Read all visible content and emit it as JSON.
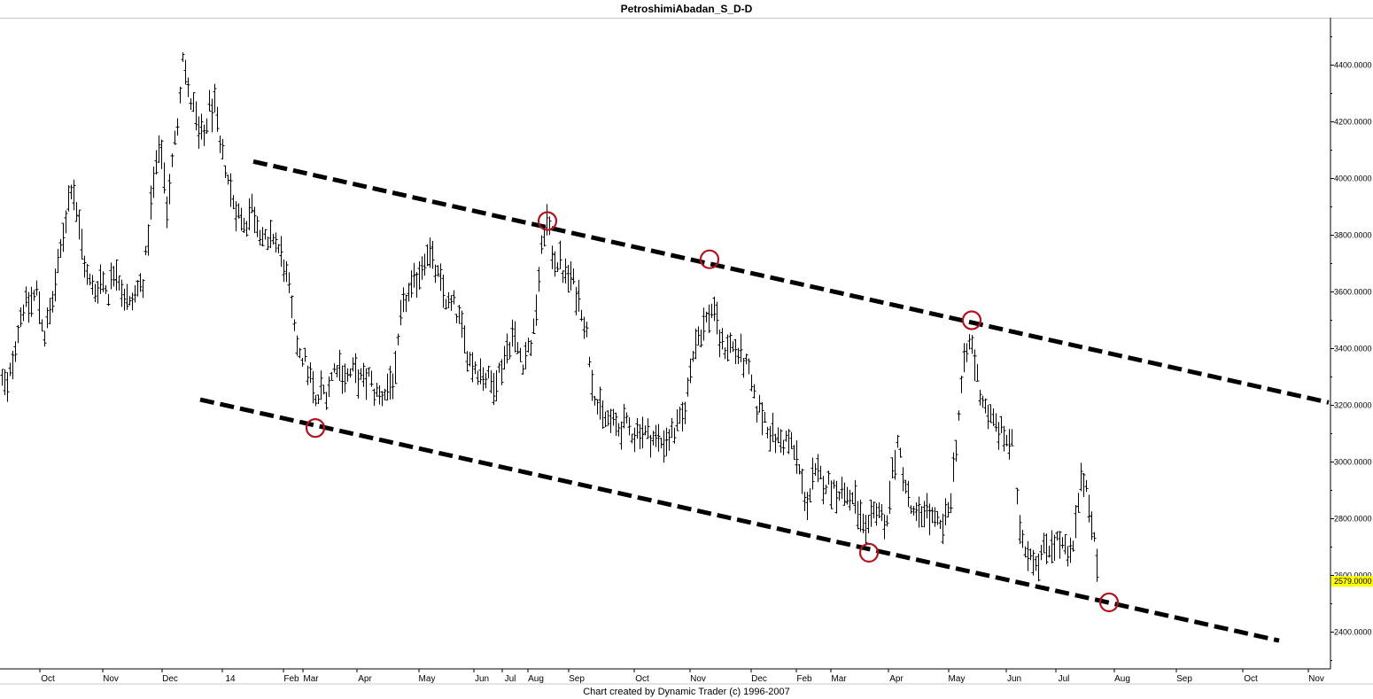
{
  "window": {
    "title": "PetroshimiAbadan_S_D-D",
    "footer": "Chart created by Dynamic Trader  (c) 1996-2007"
  },
  "chart_data": {
    "type": "ohlc-bar",
    "title": "PetroshimiAbadan_S_D-D",
    "y_axis": {
      "position": "right",
      "ylim": [
        2280,
        4560
      ],
      "ticks": [
        "2400.0000",
        "2600.0000",
        "2800.0000",
        "3000.0000",
        "3200.0000",
        "3400.0000",
        "3600.0000",
        "3800.0000",
        "4000.0000",
        "4200.0000",
        "4400.0000"
      ],
      "last_price_label": "2579.0000",
      "last_price": 2579,
      "last_price_color": "#ffff00"
    },
    "x_axis": {
      "ticks": [
        "Oct",
        "Nov",
        "Dec",
        "14",
        "Feb",
        "Mar",
        "Apr",
        "May",
        "Jun",
        "Jul",
        "Aug",
        "Sep",
        "Oct",
        "Nov",
        "Dec",
        "Feb",
        "Mar",
        "Apr",
        "May",
        "Jun",
        "Jul",
        "Aug",
        "Sep",
        "Oct",
        "Nov"
      ]
    },
    "price_path": [
      [
        0,
        3300
      ],
      [
        8,
        3250
      ],
      [
        16,
        3400
      ],
      [
        25,
        3550
      ],
      [
        33,
        3550
      ],
      [
        41,
        3600
      ],
      [
        50,
        3450
      ],
      [
        58,
        3550
      ],
      [
        66,
        3700
      ],
      [
        73,
        3850
      ],
      [
        81,
        4000
      ],
      [
        90,
        3800
      ],
      [
        98,
        3650
      ],
      [
        106,
        3600
      ],
      [
        114,
        3650
      ],
      [
        122,
        3600
      ],
      [
        130,
        3700
      ],
      [
        138,
        3600
      ],
      [
        146,
        3550
      ],
      [
        154,
        3600
      ],
      [
        162,
        3650
      ],
      [
        170,
        3900
      ],
      [
        176,
        4050
      ],
      [
        182,
        4100
      ],
      [
        188,
        3900
      ],
      [
        194,
        4050
      ],
      [
        200,
        4200
      ],
      [
        206,
        4450
      ],
      [
        212,
        4300
      ],
      [
        218,
        4250
      ],
      [
        224,
        4150
      ],
      [
        230,
        4150
      ],
      [
        236,
        4250
      ],
      [
        242,
        4250
      ],
      [
        248,
        4100
      ],
      [
        254,
        4050
      ],
      [
        260,
        3950
      ],
      [
        266,
        3900
      ],
      [
        272,
        3850
      ],
      [
        278,
        3850
      ],
      [
        284,
        3900
      ],
      [
        290,
        3850
      ],
      [
        296,
        3800
      ],
      [
        302,
        3750
      ],
      [
        308,
        3800
      ],
      [
        314,
        3750
      ],
      [
        320,
        3700
      ],
      [
        326,
        3600
      ],
      [
        332,
        3450
      ],
      [
        338,
        3400
      ],
      [
        344,
        3350
      ],
      [
        350,
        3300
      ],
      [
        356,
        3200
      ],
      [
        362,
        3250
      ],
      [
        368,
        3250
      ],
      [
        374,
        3300
      ],
      [
        380,
        3350
      ],
      [
        386,
        3320
      ],
      [
        392,
        3300
      ],
      [
        398,
        3320
      ],
      [
        404,
        3300
      ],
      [
        410,
        3280
      ],
      [
        416,
        3300
      ],
      [
        422,
        3250
      ],
      [
        428,
        3230
      ],
      [
        434,
        3250
      ],
      [
        440,
        3280
      ],
      [
        446,
        3300
      ],
      [
        452,
        3500
      ],
      [
        458,
        3580
      ],
      [
        464,
        3600
      ],
      [
        470,
        3650
      ],
      [
        476,
        3700
      ],
      [
        482,
        3750
      ],
      [
        488,
        3700
      ],
      [
        494,
        3650
      ],
      [
        500,
        3600
      ],
      [
        506,
        3550
      ],
      [
        512,
        3550
      ],
      [
        518,
        3500
      ],
      [
        524,
        3420
      ],
      [
        530,
        3360
      ],
      [
        536,
        3340
      ],
      [
        542,
        3320
      ],
      [
        548,
        3300
      ],
      [
        554,
        3280
      ],
      [
        560,
        3300
      ],
      [
        566,
        3340
      ],
      [
        572,
        3400
      ],
      [
        578,
        3450
      ],
      [
        584,
        3400
      ],
      [
        590,
        3360
      ],
      [
        596,
        3400
      ],
      [
        602,
        3450
      ],
      [
        608,
        3650
      ],
      [
        614,
        3820
      ],
      [
        618,
        3850
      ],
      [
        622,
        3750
      ],
      [
        626,
        3720
      ],
      [
        632,
        3700
      ],
      [
        638,
        3650
      ],
      [
        644,
        3650
      ],
      [
        650,
        3600
      ],
      [
        656,
        3550
      ],
      [
        662,
        3450
      ],
      [
        668,
        3300
      ],
      [
        674,
        3200
      ],
      [
        680,
        3150
      ],
      [
        686,
        3150
      ],
      [
        692,
        3130
      ],
      [
        698,
        3120
      ],
      [
        704,
        3130
      ],
      [
        710,
        3120
      ],
      [
        716,
        3100
      ],
      [
        722,
        3120
      ],
      [
        728,
        3100
      ],
      [
        734,
        3090
      ],
      [
        740,
        3080
      ],
      [
        746,
        3070
      ],
      [
        752,
        3080
      ],
      [
        758,
        3100
      ],
      [
        764,
        3120
      ],
      [
        770,
        3150
      ],
      [
        776,
        3250
      ],
      [
        782,
        3400
      ],
      [
        788,
        3450
      ],
      [
        794,
        3480
      ],
      [
        800,
        3520
      ],
      [
        806,
        3550
      ],
      [
        810,
        3450
      ],
      [
        816,
        3400
      ],
      [
        822,
        3420
      ],
      [
        828,
        3400
      ],
      [
        834,
        3380
      ],
      [
        840,
        3350
      ],
      [
        846,
        3300
      ],
      [
        852,
        3200
      ],
      [
        858,
        3180
      ],
      [
        864,
        3150
      ],
      [
        870,
        3100
      ],
      [
        876,
        3080
      ],
      [
        882,
        3070
      ],
      [
        888,
        3080
      ],
      [
        894,
        3050
      ],
      [
        900,
        3000
      ],
      [
        906,
        2900
      ],
      [
        912,
        2850
      ],
      [
        918,
        2950
      ],
      [
        924,
        2950
      ],
      [
        930,
        2930
      ],
      [
        936,
        2920
      ],
      [
        942,
        2910
      ],
      [
        948,
        2900
      ],
      [
        954,
        2890
      ],
      [
        960,
        2870
      ],
      [
        966,
        2850
      ],
      [
        972,
        2780
      ],
      [
        978,
        2720
      ],
      [
        984,
        2800
      ],
      [
        990,
        2850
      ],
      [
        996,
        2800
      ],
      [
        1002,
        2800
      ],
      [
        1008,
        3000
      ],
      [
        1014,
        3050
      ],
      [
        1020,
        2950
      ],
      [
        1026,
        2850
      ],
      [
        1032,
        2800
      ],
      [
        1038,
        2800
      ],
      [
        1044,
        2850
      ],
      [
        1050,
        2800
      ],
      [
        1056,
        2780
      ],
      [
        1062,
        2760
      ],
      [
        1068,
        2800
      ],
      [
        1074,
        2900
      ],
      [
        1080,
        3100
      ],
      [
        1086,
        3300
      ],
      [
        1092,
        3400
      ],
      [
        1096,
        3430
      ],
      [
        1100,
        3350
      ],
      [
        1106,
        3250
      ],
      [
        1112,
        3200
      ],
      [
        1118,
        3150
      ],
      [
        1124,
        3130
      ],
      [
        1130,
        3100
      ],
      [
        1136,
        3080
      ],
      [
        1142,
        3060
      ],
      [
        1146,
        2900
      ],
      [
        1152,
        2750
      ],
      [
        1158,
        2700
      ],
      [
        1164,
        2680
      ],
      [
        1170,
        2650
      ],
      [
        1176,
        2680
      ],
      [
        1182,
        2700
      ],
      [
        1188,
        2720
      ],
      [
        1194,
        2720
      ],
      [
        1200,
        2700
      ],
      [
        1206,
        2650
      ],
      [
        1212,
        2700
      ],
      [
        1218,
        2900
      ],
      [
        1224,
        2950
      ],
      [
        1230,
        2850
      ],
      [
        1236,
        2700
      ],
      [
        1240,
        2579
      ]
    ],
    "trendlines": [
      {
        "name": "upper-channel-line",
        "style": "dashed",
        "color": "#000000",
        "points": [
          [
            286,
            4060
          ],
          [
            1500,
            3210
          ]
        ]
      },
      {
        "name": "lower-channel-line",
        "style": "dashed",
        "color": "#000000",
        "points": [
          [
            226,
            3220
          ],
          [
            1444,
            2370
          ]
        ]
      }
    ],
    "touch_markers": [
      {
        "x": 356,
        "y": 3120
      },
      {
        "x": 618,
        "y": 3850
      },
      {
        "x": 801,
        "y": 3715
      },
      {
        "x": 981,
        "y": 2680
      },
      {
        "x": 1097,
        "y": 3500
      },
      {
        "x": 1252,
        "y": 2505
      }
    ],
    "marker_color": "#b0141e",
    "grid": false
  }
}
